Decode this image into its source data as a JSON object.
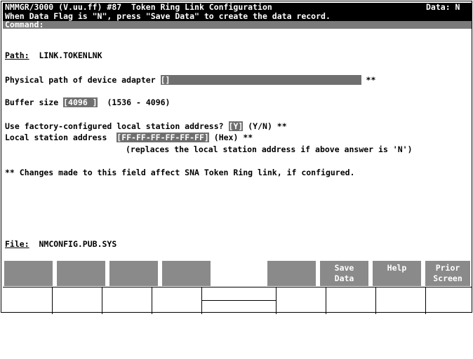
{
  "header": {
    "title": "NMMGR/3000 (V.uu.ff) #87  Token Ring Link Configuration",
    "data_flag": "Data: N",
    "message": "When Data Flag is \"N\", press \"Save Data\" to create the data record.",
    "command_label": "Command:"
  },
  "path": {
    "label": "Path:",
    "value": "LINK.TOKENLNK"
  },
  "physical_path": {
    "label": "Physical path of device adapter",
    "value": "",
    "marker": "**"
  },
  "buffer_size": {
    "label": "Buffer size",
    "value": "4096",
    "range": "(1536 - 4096)"
  },
  "factory_address": {
    "label": "Use factory-configured local station address?",
    "value": "Y",
    "hint": "(Y/N) **"
  },
  "local_address": {
    "label": "Local station address",
    "value": "FF-FF-FF-FF-FF-FF",
    "hint": "(Hex) **",
    "note": "(replaces the local station address if above answer is 'N')"
  },
  "footnote": "** Changes made to this field affect SNA Token Ring link, if configured.",
  "file": {
    "label": "File:",
    "value": "NMCONFIG.PUB.SYS"
  },
  "softkeys": [
    {
      "l1": "",
      "l2": ""
    },
    {
      "l1": "",
      "l2": ""
    },
    {
      "l1": "",
      "l2": ""
    },
    {
      "l1": "",
      "l2": ""
    },
    {
      "l1": "",
      "l2": ""
    },
    {
      "l1": "Save",
      "l2": "Data"
    },
    {
      "l1": "Help",
      "l2": ""
    },
    {
      "l1": "Prior",
      "l2": "Screen"
    }
  ],
  "colors": {
    "header_bg": "#000000",
    "field_bg": "#6f6f6f",
    "softkey_bg": "#8a8a8a"
  }
}
